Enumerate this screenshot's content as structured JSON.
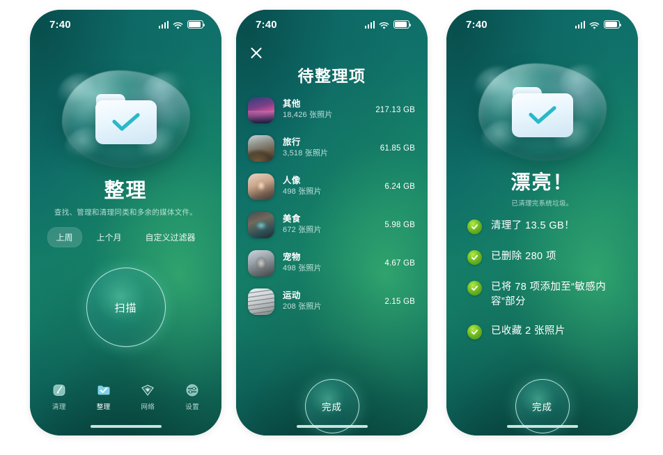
{
  "status_bar": {
    "time": "7:40",
    "signal_icon": "cellular-signal-icon",
    "wifi_icon": "wifi-icon",
    "battery_icon": "battery-icon"
  },
  "screen1": {
    "hero_icon": "folder-check-icon",
    "title": "整理",
    "subtitle": "查找、管理和清理同类和多余的媒体文件。",
    "filters": [
      {
        "label": "上周",
        "active": true
      },
      {
        "label": "上个月",
        "active": false
      },
      {
        "label": "自定义过滤器",
        "active": false
      }
    ],
    "scan_button": "扫描",
    "tabs": [
      {
        "label": "清理",
        "icon": "broom-disc-icon",
        "active": false
      },
      {
        "label": "整理",
        "icon": "folder-check-icon",
        "active": true
      },
      {
        "label": "网络",
        "icon": "wifi-diamond-icon",
        "active": false
      },
      {
        "label": "设置",
        "icon": "settings-sliders-icon",
        "active": false
      }
    ]
  },
  "screen2": {
    "close_icon": "close-icon",
    "title": "待整理项",
    "items": [
      {
        "name": "其他",
        "count": "18,426 张照片",
        "size": "217.13 GB",
        "thumb": "t-other"
      },
      {
        "name": "旅行",
        "count": "3,518 张照片",
        "size": "61.85 GB",
        "thumb": "t-travel"
      },
      {
        "name": "人像",
        "count": "498 张照片",
        "size": "6.24 GB",
        "thumb": "t-people"
      },
      {
        "name": "美食",
        "count": "672 张照片",
        "size": "5.98 GB",
        "thumb": "t-food"
      },
      {
        "name": "宠物",
        "count": "498 张照片",
        "size": "4.67 GB",
        "thumb": "t-pet"
      },
      {
        "name": "运动",
        "count": "208 张照片",
        "size": "2.15 GB",
        "thumb": "t-sport"
      }
    ],
    "done_button": "完成"
  },
  "screen3": {
    "hero_icon": "folder-check-icon",
    "title": "漂亮！",
    "subtitle": "已清理完系统垃圾。",
    "results": [
      {
        "text": "清理了 13.5 GB！",
        "icon": "check-circle-icon"
      },
      {
        "text": "已删除 280 项",
        "icon": "check-circle-icon"
      },
      {
        "text": "已将 78 项添加至“敏感内容”部分",
        "icon": "check-circle-icon"
      },
      {
        "text": "已收藏 2 张照片",
        "icon": "check-circle-icon"
      }
    ],
    "done_button": "完成"
  },
  "colors": {
    "bg_dark_teal": "#0c5b56",
    "bg_green": "#16876c",
    "accent_check_green": "#7dc62a",
    "text_white": "#ffffff",
    "folder_white": "#eef8fd"
  }
}
